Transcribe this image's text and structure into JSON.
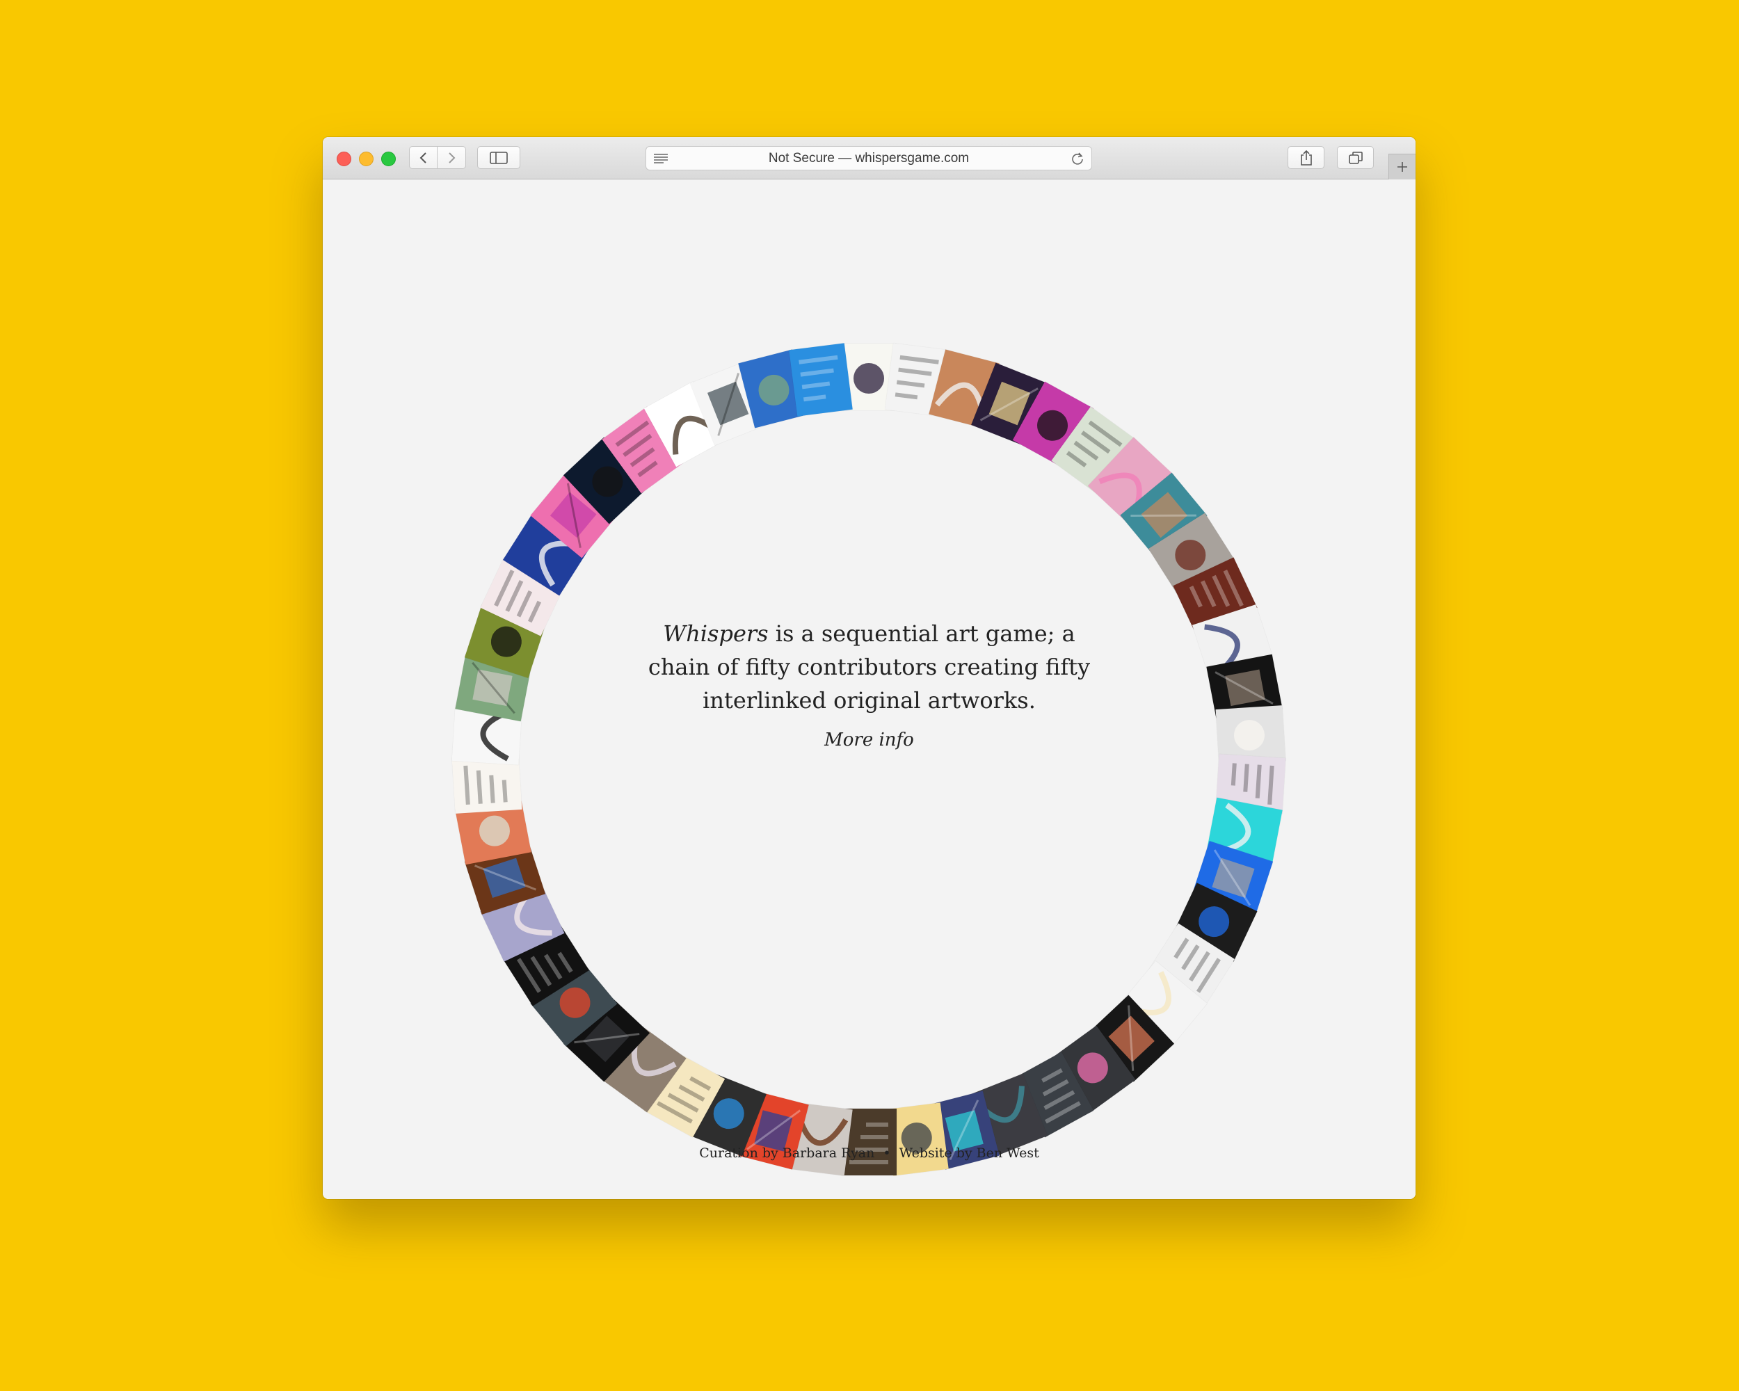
{
  "browser": {
    "address": "Not Secure — whispersgame.com",
    "icons": [
      "close-light",
      "minimize-light",
      "zoom-light",
      "back-chevron-icon",
      "forward-chevron-icon",
      "sidebar-icon",
      "reader-icon",
      "reload-icon",
      "share-icon",
      "tabs-icon",
      "new-tab-plus-icon"
    ]
  },
  "intro": {
    "title_em": "Whispers",
    "text": "is a sequential art game; a chain of fifty contributors creating fifty interlinked original artworks.",
    "more": "More info"
  },
  "credits": {
    "curation": "Curation by Barbara Ryan",
    "separator": "•",
    "website": "Website by Ben West"
  },
  "ring": {
    "count": 50,
    "colors": [
      "#F7F7F2",
      "#F3F3F3",
      "#C9875B",
      "#2A1E3A",
      "#C53AA8",
      "#D9E2D3",
      "#E8A6C3",
      "#3D8C9A",
      "#A8A29C",
      "#6E2A1E",
      "#F1F1F1",
      "#141414",
      "#E3E3E3",
      "#E6DDE8",
      "#2CD6DA",
      "#1F6BE6",
      "#1C1C1C",
      "#F0F0F0",
      "#F4F4F4",
      "#171717",
      "#34363A",
      "#3A3F45",
      "#3C3C42",
      "#37427A",
      "#F2D98E",
      "#4B3B2A",
      "#CFC9C4",
      "#E3442A",
      "#2E2E2E",
      "#F5E7C0",
      "#8E7F70",
      "#111111",
      "#3E4B52",
      "#121212",
      "#A7A5CC",
      "#6B3618",
      "#E27A56",
      "#F8F5F0",
      "#F7F7F7",
      "#7FA87E",
      "#7C8F2F",
      "#F4E8EA",
      "#203E9C",
      "#EE6FAF",
      "#0D1A2E",
      "#F080B8",
      "#FFFFFF",
      "#F5F5F5",
      "#2E6FC9",
      "#2A8FE0"
    ]
  }
}
